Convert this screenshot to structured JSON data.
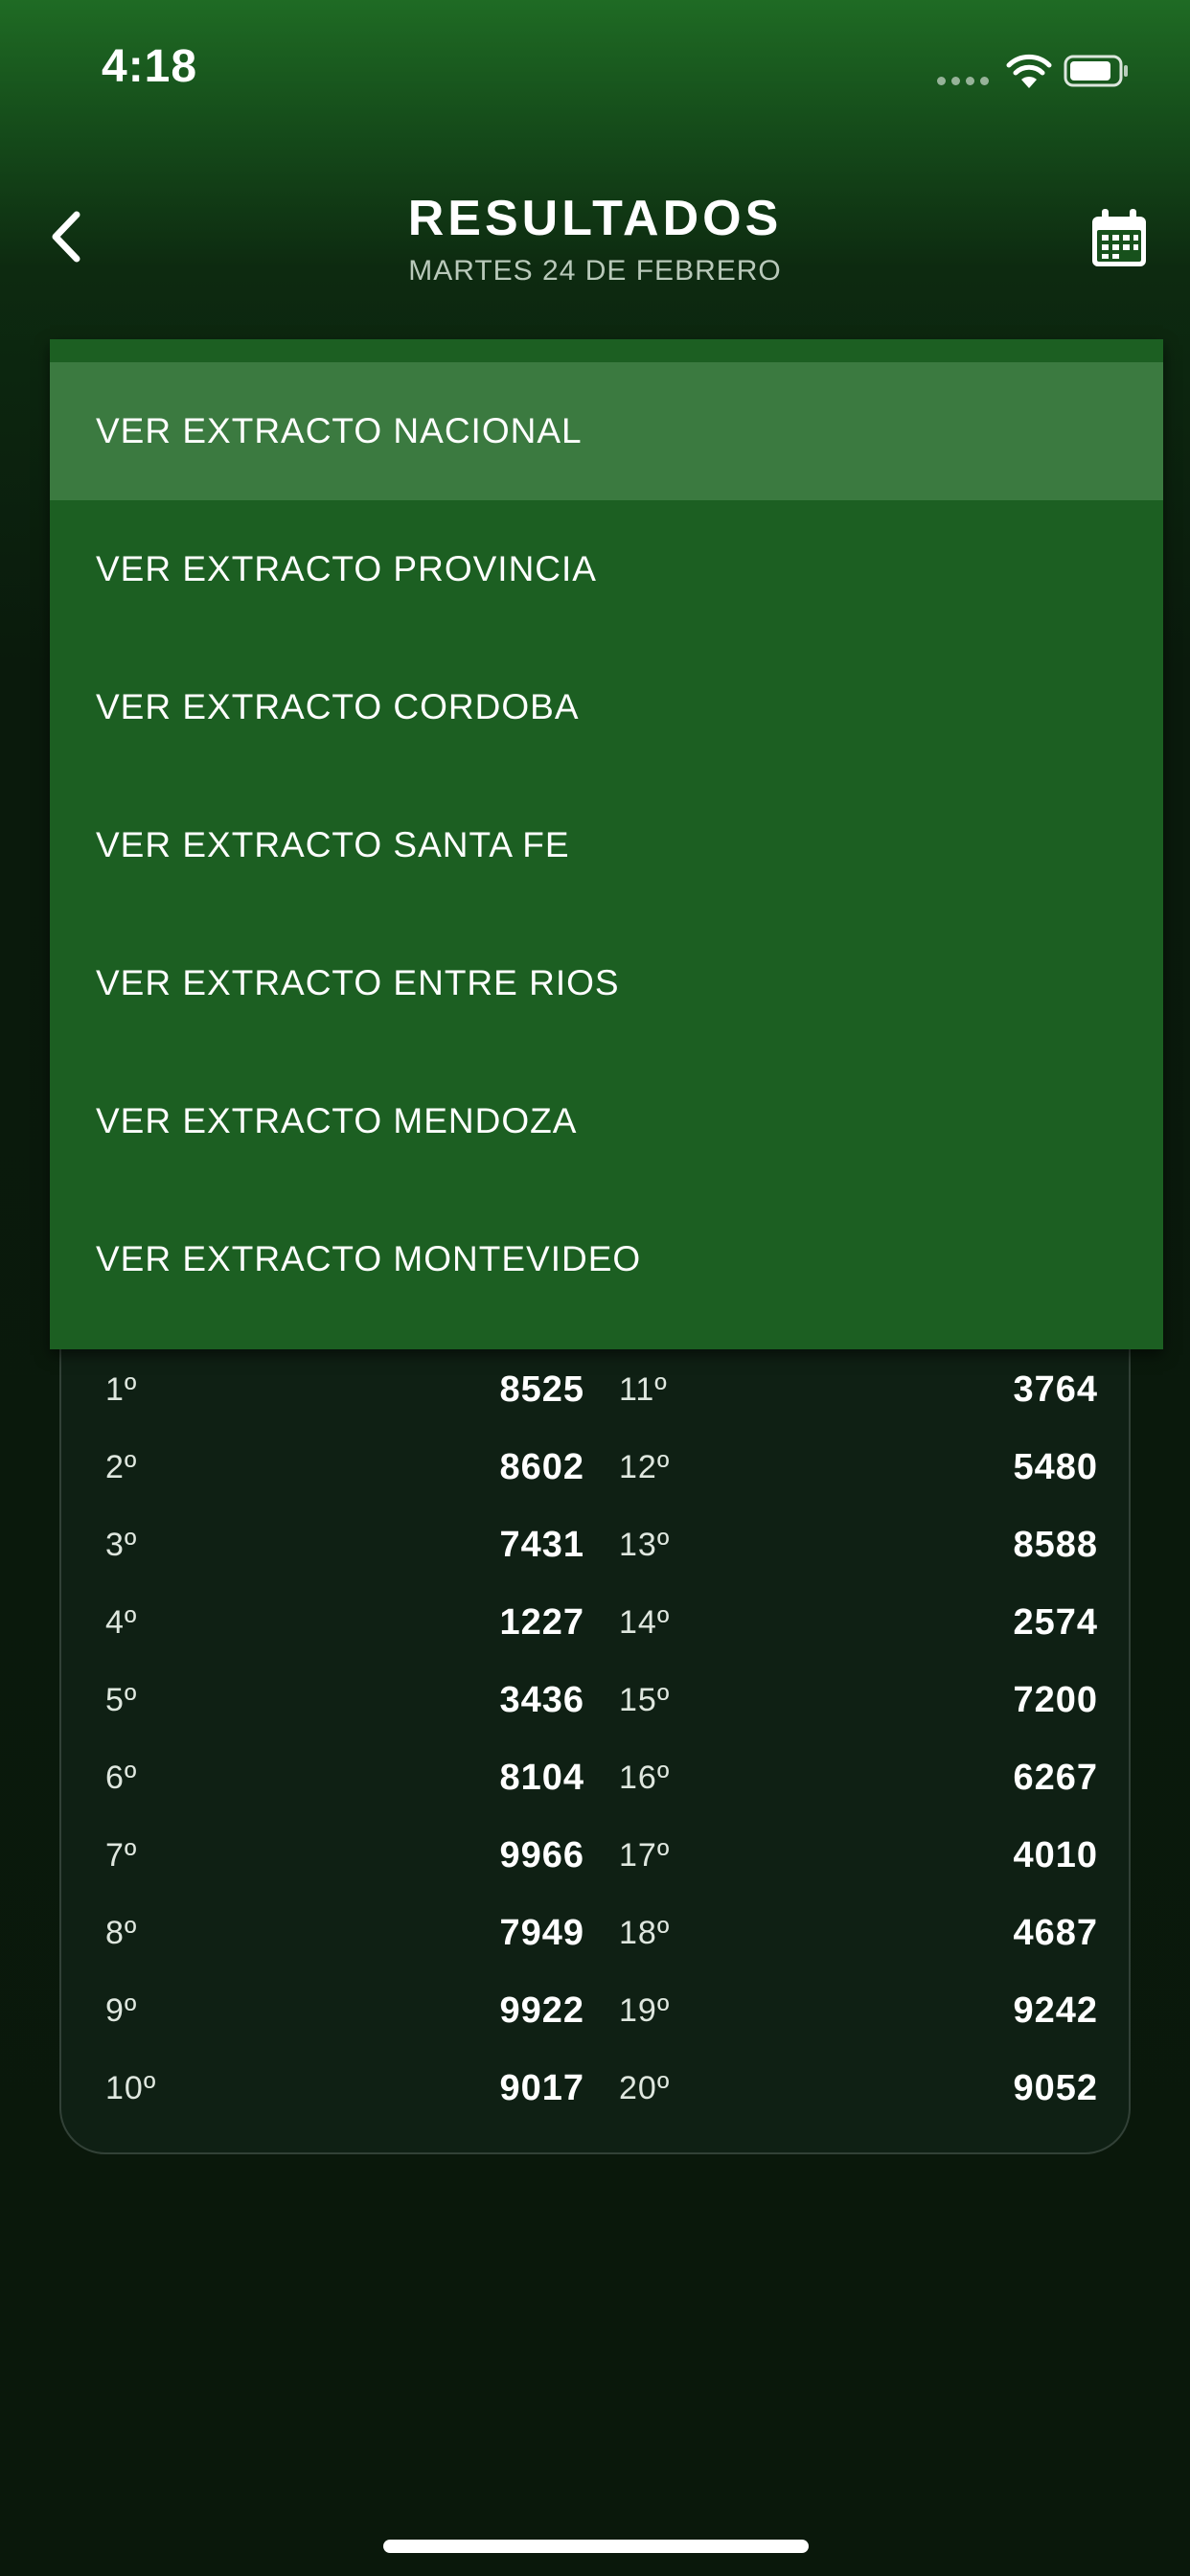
{
  "status_bar": {
    "time": "4:18"
  },
  "header": {
    "title": "RESULTADOS",
    "subtitle": "MARTES 24 DE FEBRERO",
    "back_icon": "chevron-left-icon",
    "calendar_icon": "calendar-icon"
  },
  "dropdown": {
    "items": [
      {
        "label": "VER EXTRACTO NACIONAL",
        "active": true
      },
      {
        "label": "VER EXTRACTO PROVINCIA",
        "active": false
      },
      {
        "label": "VER EXTRACTO CORDOBA",
        "active": false
      },
      {
        "label": "VER EXTRACTO SANTA FE",
        "active": false
      },
      {
        "label": "VER EXTRACTO ENTRE RIOS",
        "active": false
      },
      {
        "label": "VER EXTRACTO MENDOZA",
        "active": false
      },
      {
        "label": "VER EXTRACTO MONTEVIDEO",
        "active": false
      }
    ]
  },
  "results": {
    "left": [
      {
        "pos": "1º",
        "num": "8525"
      },
      {
        "pos": "2º",
        "num": "8602"
      },
      {
        "pos": "3º",
        "num": "7431"
      },
      {
        "pos": "4º",
        "num": "1227"
      },
      {
        "pos": "5º",
        "num": "3436"
      },
      {
        "pos": "6º",
        "num": "8104"
      },
      {
        "pos": "7º",
        "num": "9966"
      },
      {
        "pos": "8º",
        "num": "7949"
      },
      {
        "pos": "9º",
        "num": "9922"
      },
      {
        "pos": "10º",
        "num": "9017"
      }
    ],
    "right": [
      {
        "pos": "11º",
        "num": "3764"
      },
      {
        "pos": "12º",
        "num": "5480"
      },
      {
        "pos": "13º",
        "num": "8588"
      },
      {
        "pos": "14º",
        "num": "2574"
      },
      {
        "pos": "15º",
        "num": "7200"
      },
      {
        "pos": "16º",
        "num": "6267"
      },
      {
        "pos": "17º",
        "num": "4010"
      },
      {
        "pos": "18º",
        "num": "4687"
      },
      {
        "pos": "19º",
        "num": "9242"
      },
      {
        "pos": "20º",
        "num": "9052"
      }
    ]
  },
  "colors": {
    "header_green": "#1f6b24",
    "dropdown_bg": "#1c5f22",
    "dropdown_active": "#3b7a40",
    "background_dark": "#0a180b",
    "card_bg": "#0f2014"
  }
}
